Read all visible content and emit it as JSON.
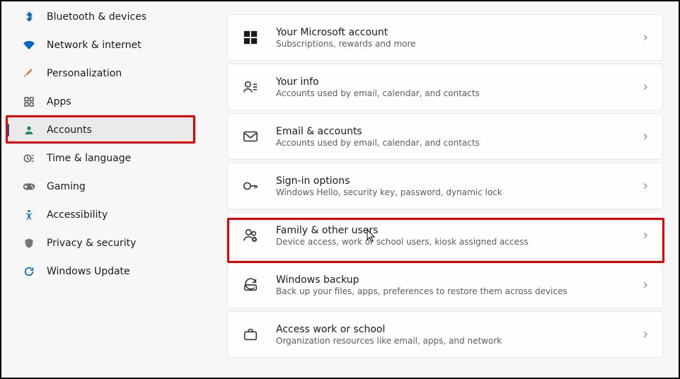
{
  "sidebar": {
    "items": [
      {
        "label": "Bluetooth & devices",
        "icon": "bluetooth"
      },
      {
        "label": "Network & internet",
        "icon": "wifi"
      },
      {
        "label": "Personalization",
        "icon": "brush"
      },
      {
        "label": "Apps",
        "icon": "apps"
      },
      {
        "label": "Accounts",
        "icon": "accounts",
        "active": true,
        "highlight": true
      },
      {
        "label": "Time & language",
        "icon": "time"
      },
      {
        "label": "Gaming",
        "icon": "gaming"
      },
      {
        "label": "Accessibility",
        "icon": "accessibility"
      },
      {
        "label": "Privacy & security",
        "icon": "privacy"
      },
      {
        "label": "Windows Update",
        "icon": "update"
      }
    ]
  },
  "cards": [
    {
      "title": "Your Microsoft account",
      "sub": "Subscriptions, rewards and more",
      "icon": "microsoft"
    },
    {
      "title": "Your info",
      "sub": "Accounts used by email, calendar, and contacts",
      "icon": "info"
    },
    {
      "title": "Email & accounts",
      "sub": "Accounts used by email, calendar, and contacts",
      "icon": "mail"
    },
    {
      "title": "Sign-in options",
      "sub": "Windows Hello, security key, password, dynamic lock",
      "icon": "key"
    },
    {
      "title": "Family & other users",
      "sub": "Device access, work or school users, kiosk assigned access",
      "icon": "family",
      "highlight": true
    },
    {
      "title": "Windows backup",
      "sub": "Back up your files, apps, preferences to restore them across devices",
      "icon": "backup"
    },
    {
      "title": "Access work or school",
      "sub": "Organization resources like email, apps, and network",
      "icon": "work"
    }
  ],
  "colors": {
    "accent": "#0067c0",
    "highlight": "#e60000"
  }
}
